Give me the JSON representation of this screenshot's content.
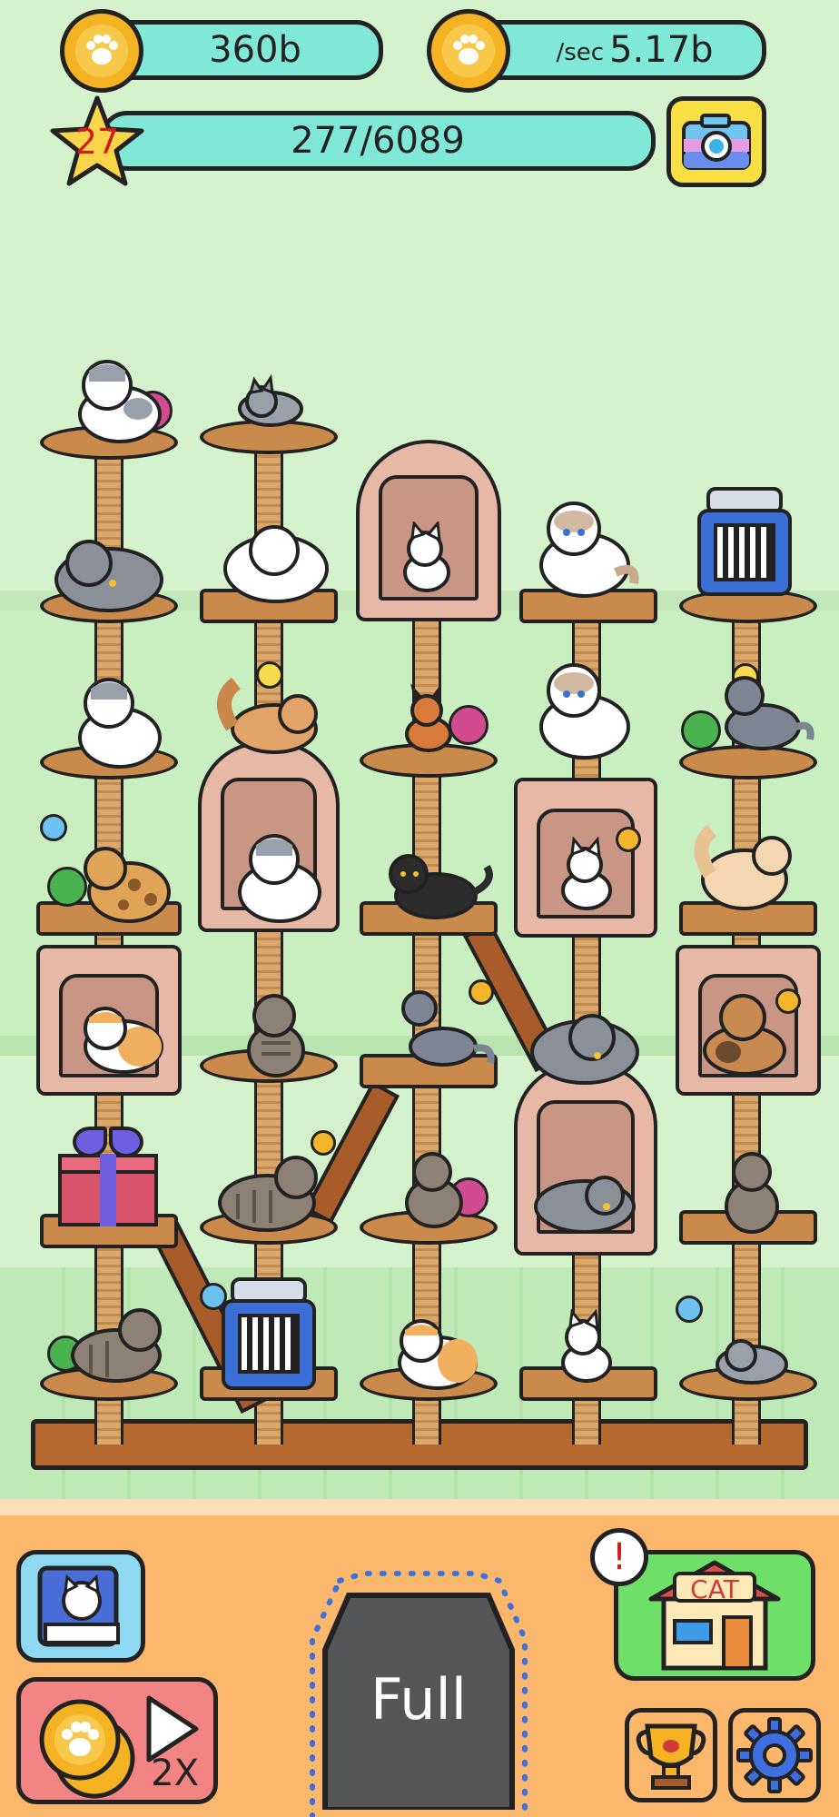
{
  "hud": {
    "coins": "360b",
    "rate_unit": "/sec",
    "rate_value": "5.17b",
    "level": "27",
    "progress_text": "277/6089",
    "progress_fraction": 0.0455
  },
  "icons": {
    "coin": "paw-coin-icon",
    "rate": "paw-coin-icon",
    "level": "star-icon",
    "camera": "camera-icon",
    "book": "cat-book-icon",
    "ad_boost": "play-2x-icon",
    "shop": "cat-shop-icon",
    "trophy": "trophy-icon",
    "settings": "gear-icon",
    "alert": "exclamation-icon"
  },
  "controls": {
    "spawn_label": "Full",
    "ad_multiplier": "2X",
    "shop_sign": "CAT",
    "alert_mark": "!"
  },
  "colors": {
    "background": "#d4f2cc",
    "bottom_bar": "#fbb86c",
    "pill": "#7fe8d6",
    "coin": "#f5b324",
    "wood": "#c98a4c"
  }
}
